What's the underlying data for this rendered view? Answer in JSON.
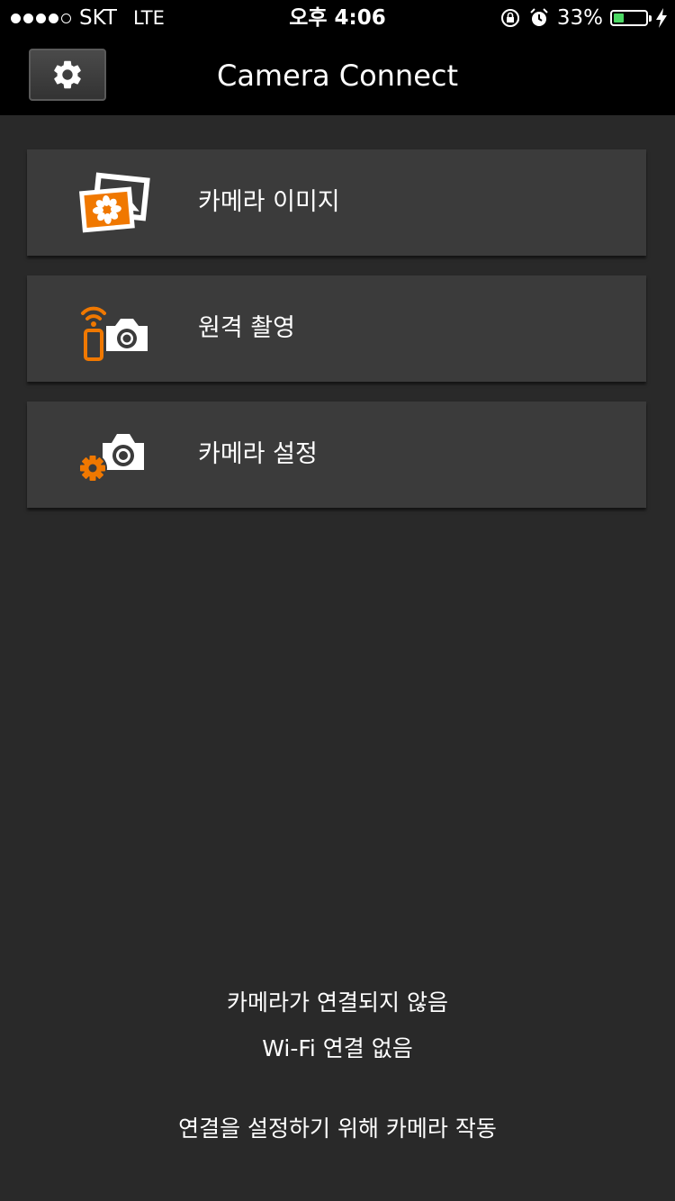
{
  "status_bar": {
    "carrier": "SKT",
    "network": "LTE",
    "time": "오후 4:06",
    "battery_percent": "33%",
    "battery_level": 0.33
  },
  "nav": {
    "title": "Camera Connect",
    "settings_icon": "gear-icon"
  },
  "menu": {
    "items": [
      {
        "label": "카메라 이미지",
        "icon": "photos-icon"
      },
      {
        "label": "원격 촬영",
        "icon": "remote-shooting-icon"
      },
      {
        "label": "카메라 설정",
        "icon": "camera-settings-icon"
      }
    ]
  },
  "status_messages": {
    "camera_not_connected": "카메라가 연결되지 않음",
    "no_wifi": "Wi-Fi 연결 없음",
    "instruction": "연결을 설정하기 위해 카메라 작동"
  },
  "colors": {
    "accent": "#f07800",
    "background": "#292929",
    "button": "#3b3b3b"
  }
}
